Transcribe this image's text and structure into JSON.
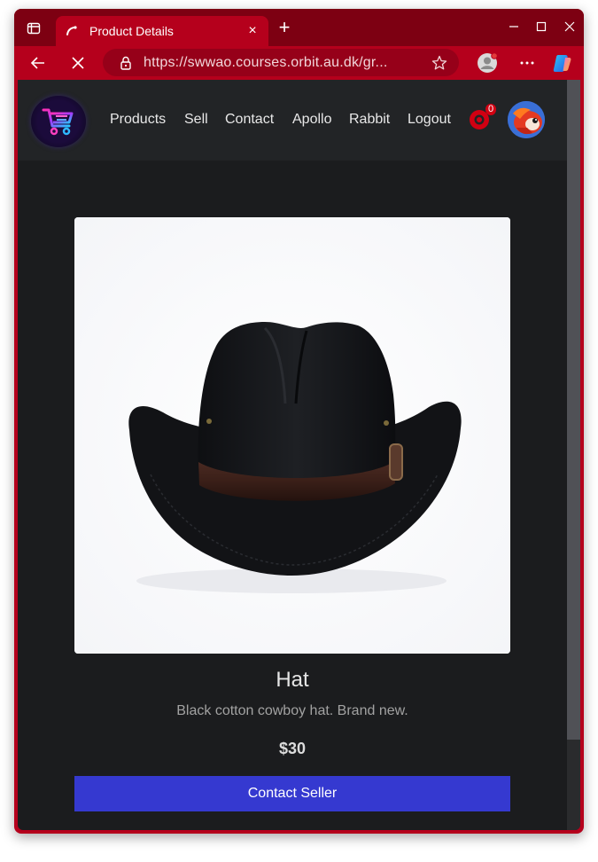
{
  "browser": {
    "tab_title": "Product Details",
    "tab_close": "×",
    "new_tab": "+",
    "url": "https://swwao.courses.orbit.au.dk/gr..."
  },
  "nav": {
    "links": [
      "Products",
      "Sell",
      "Contact",
      "Apollo",
      "Rabbit",
      "Logout"
    ],
    "notification_count": "0"
  },
  "product": {
    "title": "Hat",
    "description": "Black cotton cowboy hat. Brand new.",
    "price": "$30",
    "contact_label": "Contact Seller"
  },
  "colors": {
    "browser_accent": "#b5001c",
    "button": "#3539d0",
    "page_bg": "#1b1c1e"
  },
  "icons": [
    "tab-actions-icon",
    "favicon-icon",
    "close-icon",
    "plus-icon",
    "minimize-icon",
    "maximize-icon",
    "window-close-icon",
    "back-icon",
    "stop-icon",
    "lock-icon",
    "star-icon",
    "profile-icon",
    "more-icon",
    "copilot-icon",
    "cart-logo-icon",
    "notification-icon",
    "avatar"
  ]
}
